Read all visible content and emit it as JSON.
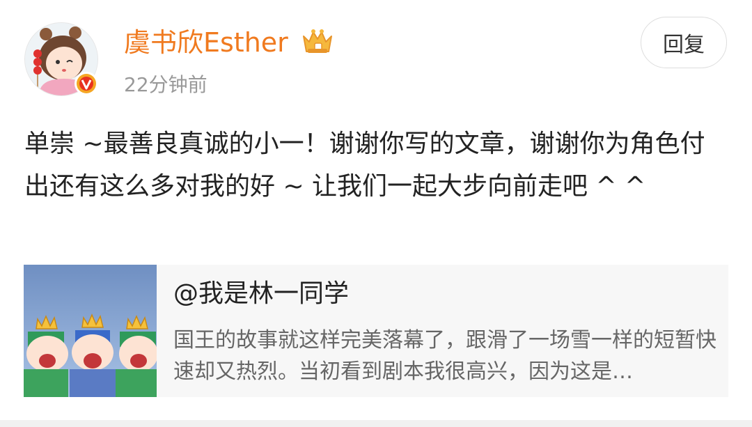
{
  "post": {
    "username": "虞书欣Esther",
    "timestamp": "22分钟前",
    "reply_label": "回复",
    "text": "单崇 ~最善良真诚的小一！谢谢你写的文章，谢谢你为角色付出还有这么多对我的好 ~ 让我们一起大步向前走吧 ^ ^",
    "avatar_icon": "avatar-cartoon-girl",
    "verified_icon": "verified-v-badge",
    "member_icon": "crown-badge-icon"
  },
  "quote": {
    "author": "@我是林一同学",
    "excerpt": "国王的故事就这样完美落幕了，跟滑了一场雪一样的短暂快速却又热烈。当初看到剧本我很高兴，因为这是…",
    "thumbnail_icon": "cartoon-kings-thumbnail"
  },
  "colors": {
    "username": "#f07a1f",
    "timestamp": "#999999",
    "card_background": "#f7f7f7",
    "badge": "#f5a623"
  }
}
